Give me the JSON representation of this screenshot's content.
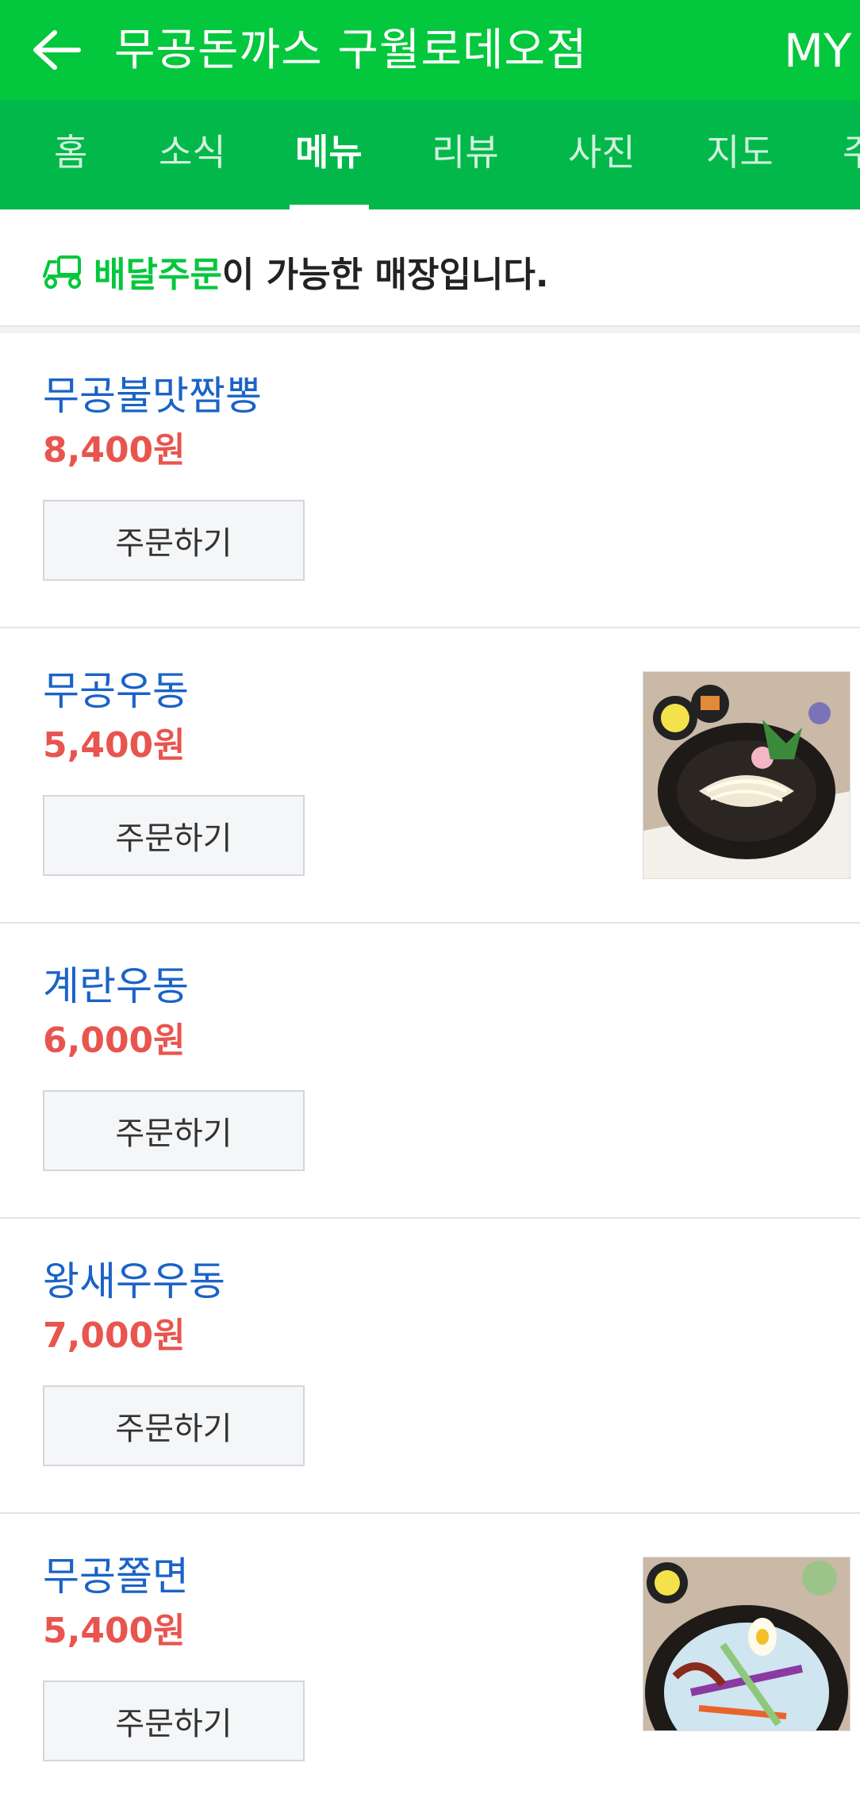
{
  "header": {
    "title": "무공돈까스 구월로데오점",
    "my_label": "MY"
  },
  "tabs": [
    {
      "label": "홈"
    },
    {
      "label": "소식"
    },
    {
      "label": "메뉴"
    },
    {
      "label": "리뷰"
    },
    {
      "label": "사진"
    },
    {
      "label": "지도"
    },
    {
      "label": "주"
    }
  ],
  "active_tab": "메뉴",
  "notice": {
    "highlight": "배달주문",
    "text": "이 가능한 매장입니다.",
    "icon": "delivery-scooter-icon"
  },
  "menu": {
    "items": [
      {
        "name": "무공불맛짬뽕",
        "price": "8,400원",
        "order_label": "주문하기",
        "has_image": false
      },
      {
        "name": "무공우동",
        "price": "5,400원",
        "order_label": "주문하기",
        "has_image": true
      },
      {
        "name": "계란우동",
        "price": "6,000원",
        "order_label": "주문하기",
        "has_image": false
      },
      {
        "name": "왕새우우동",
        "price": "7,000원",
        "order_label": "주문하기",
        "has_image": false
      },
      {
        "name": "무공쫄면",
        "price": "5,400원",
        "order_label": "주문하기",
        "has_image": true
      }
    ]
  },
  "colors": {
    "header_green": "#03c73c",
    "tab_green": "#03b84a",
    "menu_name_blue": "#1a63c7",
    "price_red": "#e8554e"
  }
}
